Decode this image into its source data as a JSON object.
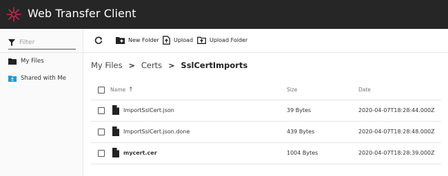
{
  "app": {
    "title": "Web Transfer Client",
    "accent_color": "#c7264d"
  },
  "sidebar": {
    "filter_placeholder": "Filter",
    "items": [
      {
        "label": "My Files",
        "icon": "folder-icon"
      },
      {
        "label": "Shared with Me",
        "icon": "shared-folder-icon"
      }
    ]
  },
  "toolbar": {
    "refresh_icon": "refresh-icon",
    "new_folder_label": "New Folder",
    "upload_label": "Upload",
    "upload_folder_label": "Upload Folder"
  },
  "breadcrumb": {
    "items": [
      "My Files",
      "Certs"
    ],
    "current": "SslCertImports",
    "separator": ">"
  },
  "table": {
    "columns": {
      "name": "Name",
      "size": "Size",
      "date": "Date"
    },
    "sort_indicator": "↑",
    "rows": [
      {
        "name": "ImportSslCert.json",
        "size": "39 Bytes",
        "date": "2020-04-07T18:28:44.000Z",
        "bold": false
      },
      {
        "name": "ImportSslCert.json.done",
        "size": "439 Bytes",
        "date": "2020-04-07T18:28:48.000Z",
        "bold": false
      },
      {
        "name": "mycert.cer",
        "size": "1004 Bytes",
        "date": "2020-04-07T18:28:39.000Z",
        "bold": true
      }
    ]
  }
}
